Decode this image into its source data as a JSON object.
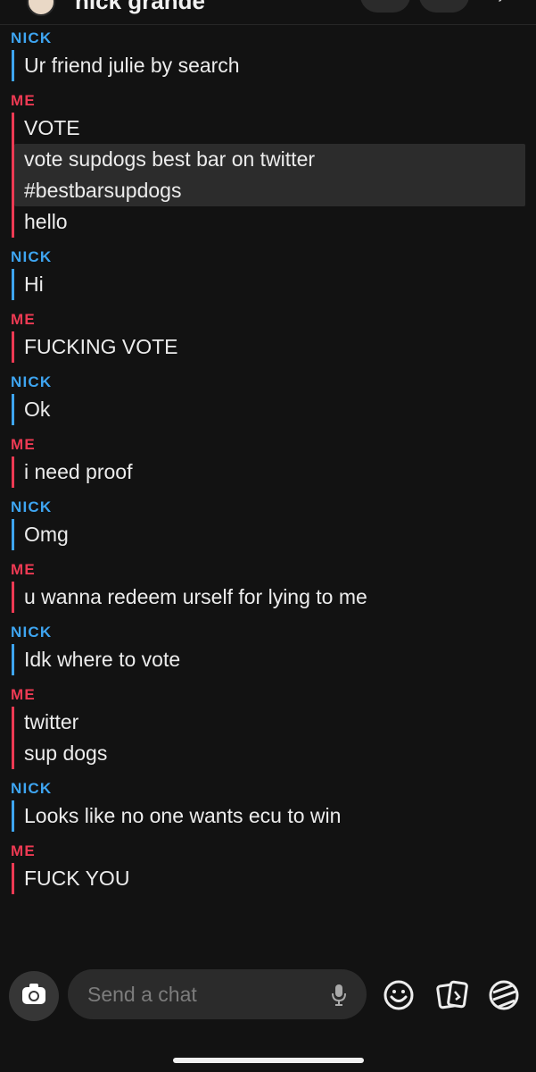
{
  "header": {
    "title": "nick grande"
  },
  "messages": [
    {
      "sender": "NICK",
      "lines": [
        "Ur friend julie by search"
      ]
    },
    {
      "sender": "ME",
      "lines": [
        "VOTE",
        "vote supdogs best bar on twitter",
        "#bestbarsupdogs",
        "hello"
      ]
    },
    {
      "sender": "NICK",
      "lines": [
        "Hi"
      ]
    },
    {
      "sender": "ME",
      "lines": [
        "FUCKING VOTE"
      ]
    },
    {
      "sender": "NICK",
      "lines": [
        "Ok"
      ]
    },
    {
      "sender": "ME",
      "lines": [
        "i need proof"
      ]
    },
    {
      "sender": "NICK",
      "lines": [
        "Omg"
      ]
    },
    {
      "sender": "ME",
      "lines": [
        "u wanna redeem urself for lying to me"
      ]
    },
    {
      "sender": "NICK",
      "lines": [
        "Idk where to vote"
      ]
    },
    {
      "sender": "ME",
      "lines": [
        "twitter",
        "sup dogs"
      ]
    },
    {
      "sender": "NICK",
      "lines": [
        "Looks like no one wants ecu to win"
      ]
    },
    {
      "sender": "ME",
      "lines": [
        "FUCK YOU"
      ]
    }
  ],
  "composer": {
    "placeholder": "Send a chat"
  },
  "colors": {
    "nick": "#3ea5f1",
    "me": "#ed3a53",
    "background": "#121212",
    "input_bg": "#2b2b2b"
  },
  "icons": [
    "camera-icon",
    "microphone-icon",
    "smiley-icon",
    "cards-icon",
    "sticker-icon"
  ]
}
